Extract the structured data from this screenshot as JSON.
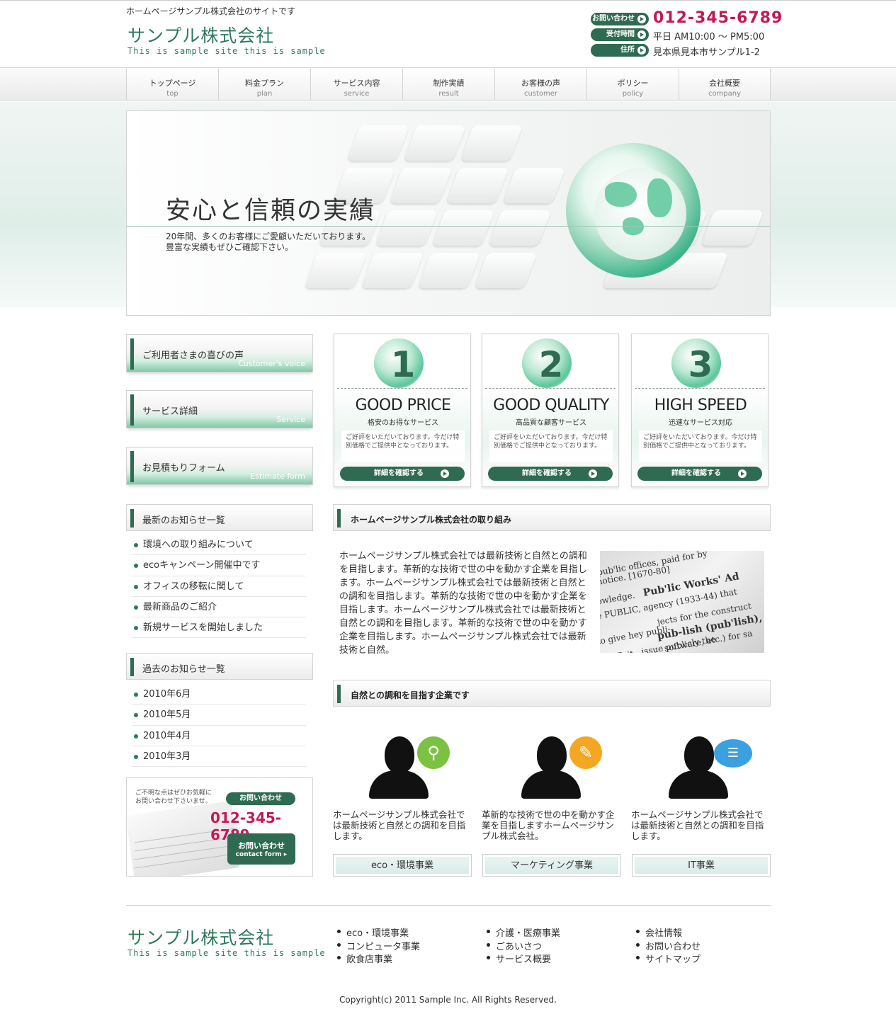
{
  "header": {
    "tagline": "ホームページサンプル株式会社のサイトです",
    "logo": "サンプル株式会社",
    "logo_sub": "This is sample site this is sample",
    "info": [
      {
        "badge": "お問い合わせ",
        "value": "012-345-6789"
      },
      {
        "badge": "受付時間",
        "value": "平日 AM10:00 ～ PM5:00"
      },
      {
        "badge": "住所",
        "value": "見本県見本市サンプル1-2"
      }
    ]
  },
  "nav": [
    {
      "jp": "トップページ",
      "en": "top"
    },
    {
      "jp": "料金プラン",
      "en": "plan"
    },
    {
      "jp": "サービス内容",
      "en": "service"
    },
    {
      "jp": "制作実績",
      "en": "result"
    },
    {
      "jp": "お客様の声",
      "en": "customer"
    },
    {
      "jp": "ポリシー",
      "en": "policy"
    },
    {
      "jp": "会社概要",
      "en": "company"
    }
  ],
  "hero": {
    "title": "安心と信頼の実績",
    "line1": "20年間、多くのお客様にご愛顧いただいております。",
    "line2": "豊富な実績もぜひご確認下さい。"
  },
  "sidebar": {
    "banners": [
      {
        "jp": "ご利用者さまの喜びの声",
        "en": "Customer's voice"
      },
      {
        "jp": "サービス詳細",
        "en": "Service"
      },
      {
        "jp": "お見積もりフォーム",
        "en": "Estimate form"
      }
    ],
    "news_title": "最新のお知らせ一覧",
    "news": [
      "環境への取り組みについて",
      "ecoキャンペーン開催中です",
      "オフィスの移転に関して",
      "最新商品のご紹介",
      "新規サービスを開始しました"
    ],
    "past_title": "過去のお知らせ一覧",
    "past": [
      "2010年6月",
      "2010年5月",
      "2010年4月",
      "2010年3月"
    ],
    "contact": {
      "text1": "ご不明な点はぜひお気軽に",
      "text2": "お問い合わせ下さいませ。",
      "btn1": "お問い合わせ",
      "phone": "012-345-6789",
      "btn2a": "お問い合わせ",
      "btn2b": "contact form ▸"
    }
  },
  "features": [
    {
      "num": "1",
      "title": "GOOD PRICE",
      "sub": "格安のお得なサービス",
      "desc": "ご好評をいただいております。今だけ特別価格でご提供中となっております。",
      "btn": "詳細を確認する"
    },
    {
      "num": "2",
      "title": "GOOD QUALITY",
      "sub": "高品質な顧客サービス",
      "desc": "ご好評をいただいております。今だけ特別価格でご提供中となっております。",
      "btn": "詳細を確認する"
    },
    {
      "num": "3",
      "title": "HIGH SPEED",
      "sub": "迅速なサービス対応",
      "desc": "ご好評をいただいております。今だけ特別価格でご提供中となっております。",
      "btn": "詳細を確認する"
    }
  ],
  "section1": {
    "title": "ホームページサンプル株式会社の取り組み",
    "body": "ホームページサンプル株式会社では最新技術と自然との調和を目指します。革新的な技術で世の中を動かす企業を目指します。ホームページサンプル株式会社では最新技術と自然との調和を目指します。革新的な技術で世の中を動かす企業を目指します。ホームページサンプル株式会社では最新技術と自然との調和を目指します。革新的な技術で世の中を動かす企業を目指します。ホームページサンプル株式会社では最新技術と自然。"
  },
  "section2": {
    "title": "自然との調和を目指す企業です",
    "items": [
      {
        "icon": "magnifier-icon",
        "color": "#7cc242",
        "text": "ホームページサンプル株式会社では最新技術と自然との調和を目指します。",
        "btn": "eco・環境事業"
      },
      {
        "icon": "pencil-icon",
        "color": "#f5a623",
        "text": "革新的な技術で世の中を動かす企業を目指しますホームページサンプル株式会社。",
        "btn": "マーケティング事業"
      },
      {
        "icon": "chat-icon",
        "color": "#3aa0e0",
        "text": "ホームページサンプル株式会社では最新技術と自然との調和を目指します。",
        "btn": "IT事業"
      }
    ]
  },
  "footer": {
    "logo": "サンプル株式会社",
    "logo_sub": "This is sample site this is sample",
    "col1": [
      "eco・環境事業",
      "コンピュータ事業",
      "飲食店事業"
    ],
    "col2": [
      "介護・医療事業",
      "ごあいさつ",
      "サービス概要"
    ],
    "col3": [
      "会社情報",
      "お問い合わせ",
      "サイトマップ"
    ],
    "copyright": "Copyright(c) 2011 Sample Inc. All Rights Reserved."
  },
  "colors": {
    "accent": "#2e6b52",
    "phone": "#c2185b",
    "brand": "#2e7a5b"
  }
}
